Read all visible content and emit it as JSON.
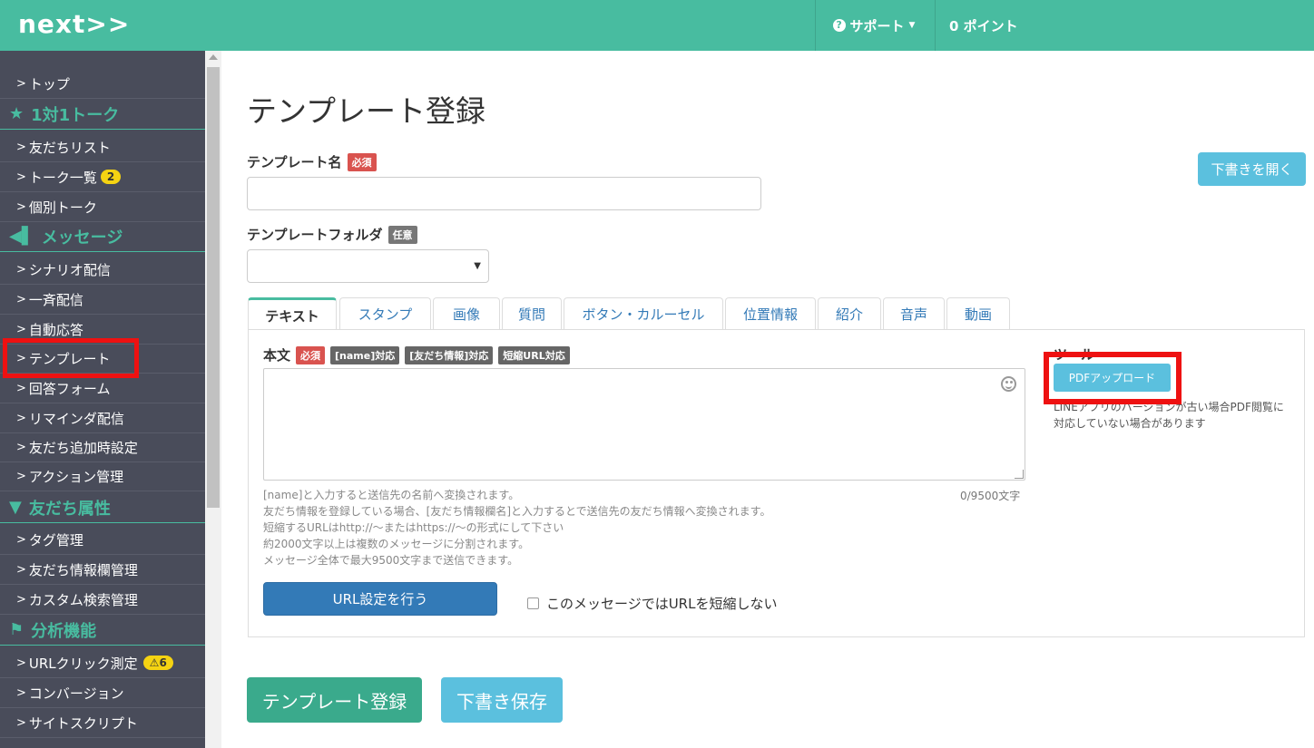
{
  "header": {
    "logo": "next>>",
    "support_label": "サポート",
    "points_label": "0 ポイント"
  },
  "sidebar": {
    "items": [
      {
        "label": "トップ"
      },
      {
        "heading": "1対1トーク",
        "icon": "star-icon"
      },
      {
        "label": "友だちリスト"
      },
      {
        "label": "トーク一覧",
        "badge": "2"
      },
      {
        "label": "個別トーク"
      },
      {
        "heading": "メッセージ",
        "icon": "megaphone-icon"
      },
      {
        "label": "シナリオ配信"
      },
      {
        "label": "一斉配信"
      },
      {
        "label": "自動応答"
      },
      {
        "label": "テンプレート",
        "highlighted": true
      },
      {
        "label": "回答フォーム"
      },
      {
        "label": "リマインダ配信"
      },
      {
        "label": "友だち追加時設定"
      },
      {
        "label": "アクション管理"
      },
      {
        "heading": "友だち属性",
        "icon": "filter-icon"
      },
      {
        "label": "タグ管理"
      },
      {
        "label": "友だち情報欄管理"
      },
      {
        "label": "カスタム検索管理"
      },
      {
        "heading": "分析機能",
        "icon": "flag-icon"
      },
      {
        "label": "URLクリック測定",
        "badge": "6"
      },
      {
        "label": "コンバージョン"
      },
      {
        "label": "サイトスクリプト"
      }
    ]
  },
  "main": {
    "page_title": "テンプレート登録",
    "template_name_label": "テンプレート名",
    "required_tag": "必須",
    "folder_label": "テンプレートフォルダ",
    "optional_tag": "任意",
    "draft_open_button": "下書きを開く",
    "tabs": [
      "テキスト",
      "スタンプ",
      "画像",
      "質問",
      "ボタン・カルーセル",
      "位置情報",
      "紹介",
      "音声",
      "動画"
    ],
    "body_label": "本文",
    "body_tags": [
      "[name]対応",
      "[友だち情報]対応",
      "短縮URL対応"
    ],
    "char_count": "0/9500文字",
    "help_lines": [
      "[name]と入力すると送信先の名前へ変換されます。",
      "友だち情報を登録している場合、[友だち情報欄名]と入力するとで送信先の友だち情報へ変換されます。",
      "短縮するURLはhttp://〜またはhttps://〜の形式にして下さい",
      "約2000文字以上は複数のメッセージに分割されます。",
      "メッセージ全体で最大9500文字まで送信できます。"
    ],
    "url_button": "URL設定を行う",
    "no_shorten_checkbox": "このメッセージではURLを短縮しない",
    "tools_title": "ツール",
    "pdf_upload_button": "PDFアップロード",
    "pdf_note": "LINEアプリのバージョンが古い場合PDF閲覧に対応していない場合があります",
    "register_button": "テンプレート登録",
    "save_draft_button": "下書き保存"
  },
  "colors": {
    "brand": "#48bca0",
    "sidebar_bg": "#494c5a",
    "highlight": "#ee1111",
    "info": "#5bc0de",
    "primary": "#337ab7"
  }
}
